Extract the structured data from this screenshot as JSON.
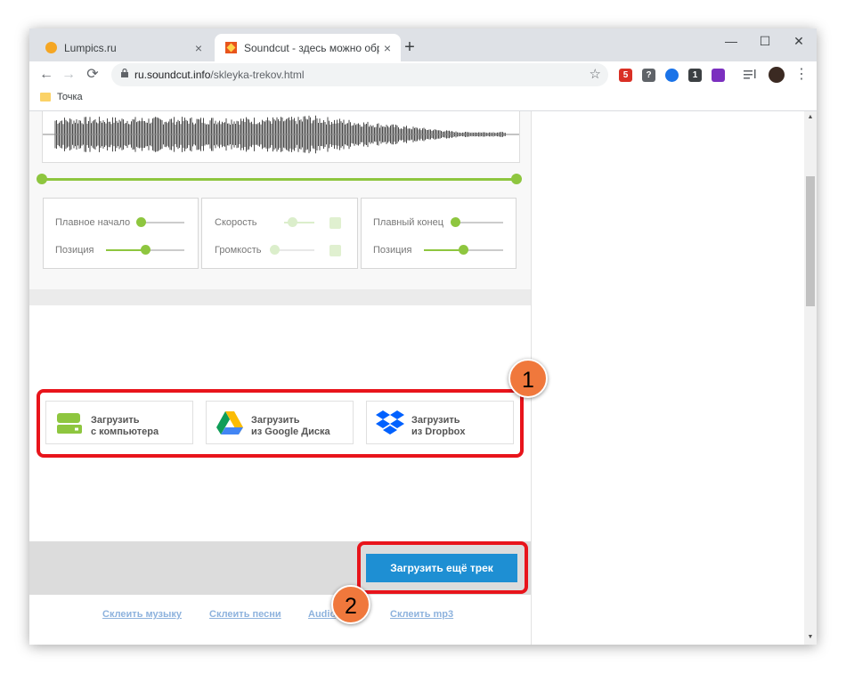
{
  "browser": {
    "tabs": [
      {
        "title": "Lumpics.ru",
        "close": "×",
        "active": false
      },
      {
        "title": "Soundcut - здесь можно обрезать",
        "close": "×",
        "active": true
      }
    ],
    "new_tab": "+",
    "window_controls": {
      "minimize": "—",
      "maximize": "☐",
      "close": "✕"
    },
    "nav": {
      "back": "←",
      "forward": "→",
      "reload": "⟳"
    },
    "address": {
      "host": "ru.soundcut.info",
      "path": "/skleyka-trekov.html"
    },
    "star": "☆",
    "extensions": [
      {
        "label": "5",
        "color": "#d93025"
      },
      {
        "label": "?",
        "color": "#5f6368"
      },
      {
        "label": "",
        "color": "#1a73e8"
      },
      {
        "label": "1",
        "color": "#3c4043"
      },
      {
        "label": "",
        "color": "#7b2fbf"
      }
    ],
    "menu": "⋮",
    "bookmarks": [
      {
        "label": "Точка"
      }
    ]
  },
  "editor": {
    "panel_fade_in": {
      "smooth_start_label": "Плавное начало",
      "position_label": "Позиция"
    },
    "panel_speed": {
      "speed_label": "Скорость",
      "volume_label": "Громкость"
    },
    "panel_fade_out": {
      "smooth_end_label": "Плавный конец",
      "position_label": "Позиция"
    }
  },
  "upload": {
    "buttons": [
      {
        "line1": "Загрузить",
        "line2": "с компьютера",
        "icon": "hard-drive-icon"
      },
      {
        "line1": "Загрузить",
        "line2": "из Google Диска",
        "icon": "google-drive-icon"
      },
      {
        "line1": "Загрузить",
        "line2": "из Dropbox",
        "icon": "dropbox-icon"
      }
    ],
    "more_button": "Загрузить ещё трек"
  },
  "annotations": {
    "badge1": "1",
    "badge2": "2"
  },
  "footer_links": [
    "Склеить музыку",
    "Склеить песни",
    "Audio",
    "Склеить mp3"
  ],
  "colors": {
    "accent_green": "#8ec63f",
    "button_blue": "#1e8fd3",
    "annotation_red": "#e8141b",
    "badge_orange": "#f0783c"
  }
}
